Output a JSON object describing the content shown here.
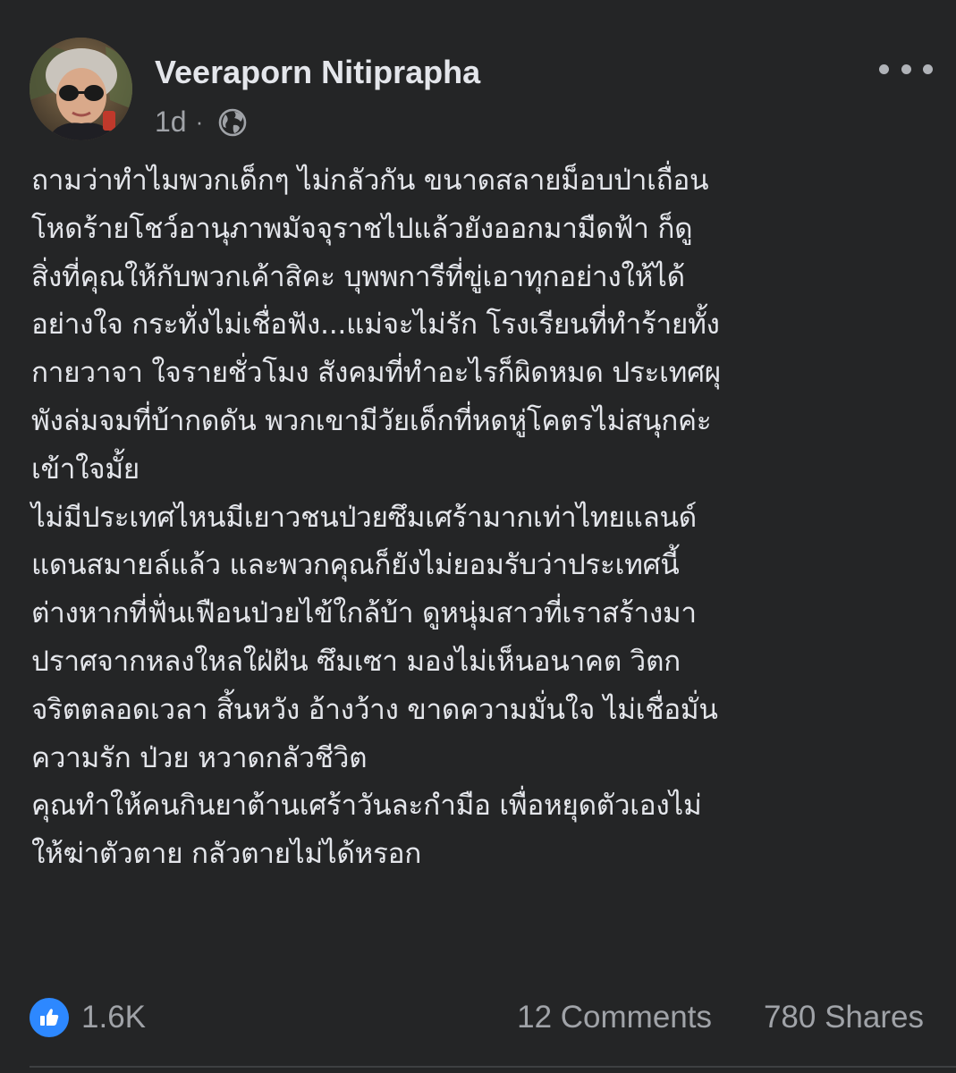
{
  "post": {
    "author": "Veeraporn Nitiprapha",
    "time": "1d",
    "separator": "·",
    "privacy_icon": "globe-icon",
    "more_icon": "more-options-icon",
    "body_lines": [
      "ถามว่าทำไมพวกเด็กๆ ไม่กลัวกัน ขนาดสลายม็อบป่าเถื่อน",
      "โหดร้ายโชว์อานุภาพมัจจุราชไปแล้วยังออกมามืดฟ้า ก็ดู",
      "สิ่งที่คุณให้กับพวกเค้าสิคะ บุพพการีที่ขู่เอาทุกอย่างให้ได้",
      "อย่างใจ กระทั่งไม่เชื่อฟัง...แม่จะไม่รัก โรงเรียนที่ทำร้ายทั้ง",
      "กายวาจา ใจรายชั่วโมง สังคมที่ทำอะไรก็ผิดหมด ประเทศผุ",
      "พังล่มจมที่บ้ากดดัน พวกเขามีวัยเด็กที่หดหู่โคตรไม่สนุกค่ะ",
      "เข้าใจมั้ย",
      "ไม่มีประเทศไหนมีเยาวชนป่วยซึมเศร้ามากเท่าไทยแลนด์",
      "แดนสมายล์แล้ว และพวกคุณก็ยังไม่ยอมรับว่าประเทศนี้",
      "ต่างหากที่ฟั่นเฟือนป่วยไข้ใกล้บ้า ดูหนุ่มสาวที่เราสร้างมา",
      "ปราศจากหลงใหลใฝ่ฝัน ซึมเซา มองไม่เห็นอนาคต วิตก",
      "จริตตลอดเวลา สิ้นหวัง อ้างว้าง ขาดความมั่นใจ ไม่เชื่อมั่น",
      "ความรัก ป่วย หวาดกลัวชีวิต",
      "คุณทำให้คนกินยาต้านเศร้าวันละกำมือ เพื่อหยุดตัวเองไม่",
      "ให้ฆ่าตัวตาย กลัวตายไม่ได้หรอก"
    ]
  },
  "footer": {
    "like_icon": "thumbs-up-icon",
    "reactions": "1.6K",
    "comments": "12 Comments",
    "shares": "780 Shares"
  },
  "colors": {
    "background": "#242526",
    "text_primary": "#e4e6eb",
    "text_secondary": "#a0a3a8",
    "like_blue": "#2d88ff"
  }
}
